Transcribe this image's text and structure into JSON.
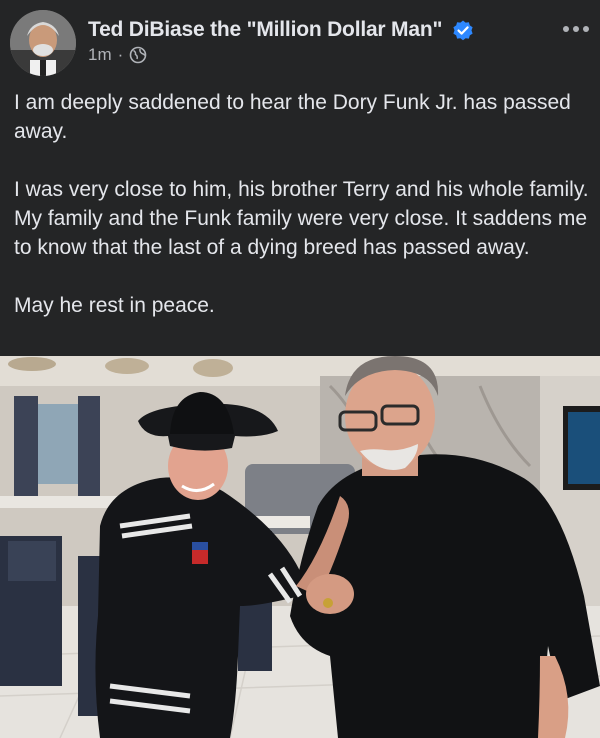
{
  "post": {
    "author": "Ted DiBiase the \"Million Dollar Man\"",
    "timestamp": "1m",
    "separator": "·",
    "audience_icon": "globe-icon",
    "verified_icon": "verified-badge-icon",
    "more_icon": "more-options-icon",
    "paragraphs": [
      "I am deeply saddened to hear the Dory Funk Jr. has passed away.",
      "I was very close to him, his brother Terry and his whole family. My family and the Funk family were very close. It saddens me to know that the last of a dying breed has passed away.",
      "May he rest in peace."
    ]
  },
  "colors": {
    "background": "#242526",
    "primary_text": "#e4e6eb",
    "secondary_text": "#b0b3b8",
    "verified": "#2d88ff"
  }
}
